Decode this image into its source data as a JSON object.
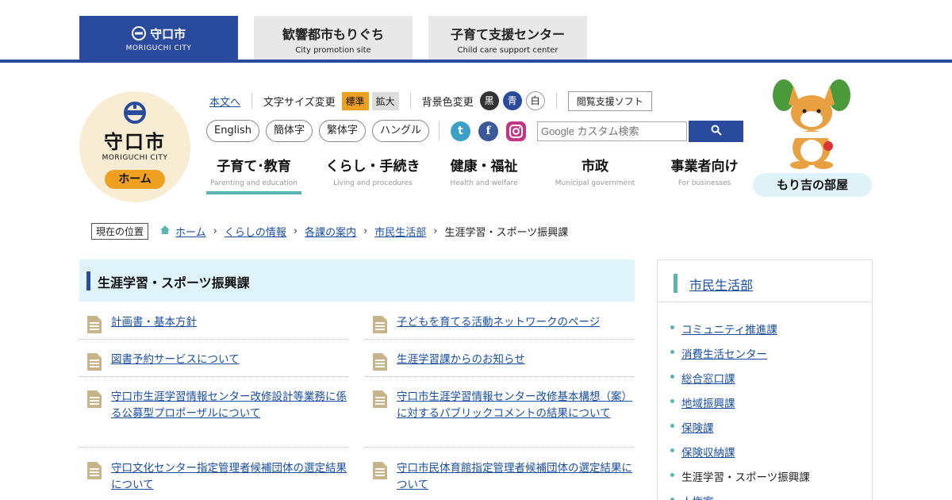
{
  "top_tabs": [
    {
      "jp": "守口市",
      "en": "MORIGUCHI CITY"
    },
    {
      "jp": "歓響都市もりぐち",
      "en": "City promotion site"
    },
    {
      "jp": "子育て支援センター",
      "en": "Child care support center"
    }
  ],
  "logo": {
    "jp": "守口市",
    "en": "MORIGUCHI CITY",
    "home": "ホーム"
  },
  "util": {
    "skip": "本文へ",
    "font_size": "文字サイズ変更",
    "standard": "標準",
    "enlarge": "拡大",
    "bg_color": "背景色変更",
    "black": "黒",
    "blue": "青",
    "white": "白",
    "reader": "閲覧支援ソフト"
  },
  "langs": [
    "English",
    "簡体字",
    "繁体字",
    "ハングル"
  ],
  "social": {
    "twitter": "t",
    "facebook": "f"
  },
  "search": {
    "placeholder": "Google カスタム検索"
  },
  "gnav": [
    {
      "jp": "子育て･教育",
      "en": "Parenting and education"
    },
    {
      "jp": "くらし・手続き",
      "en": "Living and procedures"
    },
    {
      "jp": "健康・福祉",
      "en": "Health and welfare"
    },
    {
      "jp": "市政",
      "en": "Municipal government"
    },
    {
      "jp": "事業者向け",
      "en": "For businesses"
    }
  ],
  "mascot_label": "もり吉の部屋",
  "breadcrumb": {
    "here": "現在の位置",
    "items": [
      "ホーム",
      "くらしの情報",
      "各課の案内",
      "市民生活部",
      "生涯学習・スポーツ振興課"
    ]
  },
  "page_title": "生涯学習・スポーツ振興課",
  "links": [
    "計画書・基本方針",
    "子どもを育てる活動ネットワークのページ",
    "図書予約サービスについて",
    "生涯学習課からのお知らせ",
    "守口市生涯学習情報センター改修設計等業務に係る公募型プロポーザルについて",
    "守口市生涯学習情報センター改修基本構想（案）に対するパブリックコメントの結果について",
    "守口文化センター指定管理者候補団体の選定結果について",
    "守口市民体育館指定管理者候補団体の選定結果について"
  ],
  "sidebar": {
    "title": "市民生活部",
    "items": [
      "コミュニティ推進課",
      "消費生活センター",
      "総合窓口課",
      "地域振興課",
      "保険課",
      "保険収納課",
      "生涯学習・スポーツ振興課",
      "人権室"
    ]
  },
  "colors": {
    "brand_blue": "#2a4a9e",
    "accent_orange": "#f0a020",
    "teal": "#5ab5b0",
    "light_blue": "#dff3fa"
  }
}
